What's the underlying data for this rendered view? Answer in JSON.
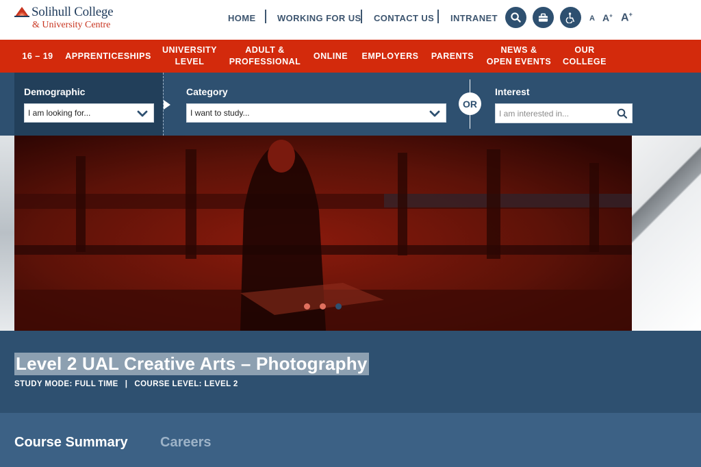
{
  "logo": {
    "name": "Solihull College",
    "subtitle": "& University Centre"
  },
  "topnav": [
    "HOME",
    "WORKING FOR US",
    "CONTACT US",
    "INTRANET"
  ],
  "font_sizes": [
    "A",
    "A",
    "A"
  ],
  "font_size_marks": [
    "+",
    "+"
  ],
  "mainnav": {
    "items": [
      {
        "line1": "16 – 19",
        "line2": ""
      },
      {
        "line1": "APPRENTICESHIPS",
        "line2": ""
      },
      {
        "line1": "UNIVERSITY",
        "line2": "LEVEL"
      },
      {
        "line1": "ADULT &",
        "line2": "PROFESSIONAL"
      },
      {
        "line1": "ONLINE",
        "line2": ""
      },
      {
        "line1": "EMPLOYERS",
        "line2": ""
      },
      {
        "line1": "PARENTS",
        "line2": ""
      },
      {
        "line1": "NEWS &",
        "line2": "OPEN EVENTS"
      },
      {
        "line1": "OUR",
        "line2": "COLLEGE"
      }
    ]
  },
  "finder": {
    "demographic_label": "Demographic",
    "demographic_value": "I am looking for...",
    "category_label": "Category",
    "category_value": "I want to study...",
    "or_text": "OR",
    "interest_label": "Interest",
    "interest_placeholder": "I am interested in..."
  },
  "carousel": {
    "slide_count": 3,
    "active_index": 2
  },
  "course": {
    "title": "Level 2 UAL Creative Arts – Photography",
    "study_mode": "STUDY MODE: FULL TIME",
    "divider": "|",
    "course_level": "COURSE LEVEL: LEVEL 2"
  },
  "tabs": [
    {
      "label": "Course Summary",
      "active": true
    },
    {
      "label": "Careers",
      "active": false
    }
  ],
  "colors": {
    "brand_red": "#d32a0c",
    "navy": "#2e5070",
    "logo_navy": "#1f3b5c"
  },
  "icons": [
    "search-icon",
    "briefcase-icon",
    "accessibility-icon",
    "chevron-down-icon",
    "search-icon"
  ]
}
